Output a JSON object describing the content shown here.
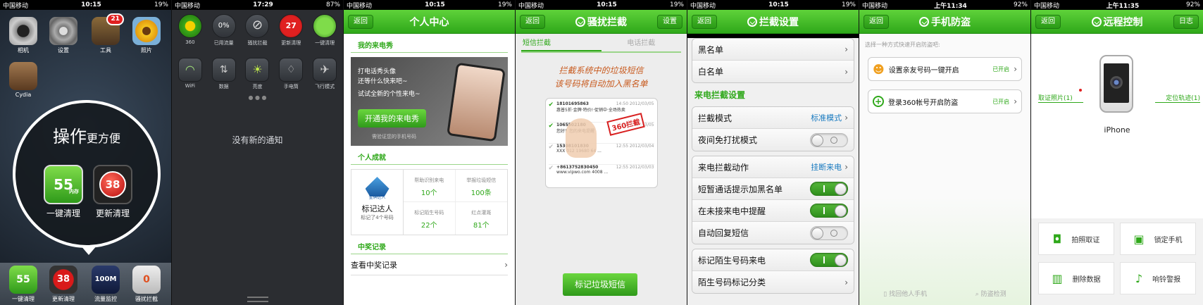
{
  "colors": {
    "brand_green": "#2fa81a",
    "badge_red": "#e02020",
    "link_blue": "#1a7bc0"
  },
  "screens": {
    "s1": {
      "status": {
        "carrier": "中国移动",
        "time": "10:15",
        "battery": "19%"
      },
      "apps": [
        {
          "label": "相机",
          "icon": "camera-icon"
        },
        {
          "label": "设置",
          "icon": "settings-gear-icon"
        },
        {
          "label": "工具",
          "icon": "folder-icon",
          "badge": "21"
        },
        {
          "label": "照片",
          "icon": "sunflower-icon"
        },
        {
          "label": "Cydia",
          "icon": "cydia-icon"
        }
      ],
      "bubble": {
        "title": "操作",
        "title_small": "更方便",
        "items": [
          {
            "label": "一键清理",
            "value": "55",
            "sub": "内存"
          },
          {
            "label": "更新清理",
            "value": "38"
          }
        ]
      },
      "dock": [
        {
          "label": "一键清理",
          "value": "55",
          "sub": "内存"
        },
        {
          "label": "更新清理",
          "value": "38"
        },
        {
          "label": "流量监控",
          "value": "100M",
          "sub": "剩余"
        },
        {
          "label": "骚扰拦截",
          "value": "0"
        }
      ]
    },
    "s2": {
      "status": {
        "carrier": "中国移动",
        "time": "17:29",
        "battery": "87%"
      },
      "row1": [
        {
          "label": "360",
          "icon": "360-logo-icon"
        },
        {
          "label": "已用流量",
          "value": "0%"
        },
        {
          "label": "骚扰拦截",
          "icon": "block-icon"
        },
        {
          "label": "更新清理",
          "value": "27"
        },
        {
          "label": "一键清理",
          "icon": "broom-icon"
        }
      ],
      "row2": [
        {
          "label": "WiFi",
          "icon": "wifi-icon"
        },
        {
          "label": "数据",
          "icon": "data-icon"
        },
        {
          "label": "亮度",
          "icon": "brightness-icon"
        },
        {
          "label": "手电筒",
          "icon": "flashlight-icon"
        },
        {
          "label": "飞行模式",
          "icon": "airplane-icon"
        }
      ],
      "empty": "没有新的通知"
    },
    "s3": {
      "status": {
        "carrier": "中国移动",
        "time": "10:15",
        "battery": "19%"
      },
      "back": "返回",
      "title": "个人中心",
      "show_header": "我的来电秀",
      "banner": {
        "line1": "打电话秀头像",
        "line2": "还等什么快来吧~",
        "line3": "试试全新的个性来电~",
        "button": "开通我的来电秀",
        "note": "需验证您的手机号码"
      },
      "ach_header": "个人成就",
      "badge_title": "标记达人",
      "badge_ribbon": "金牌达人",
      "badge_sub": "标记了4个号码",
      "stats": [
        {
          "label": "帮助识别来电",
          "value": "10个"
        },
        {
          "label": "举报垃圾短信",
          "value": "100条"
        },
        {
          "label": "标记陌生号码",
          "value": "22个"
        },
        {
          "label": "红点灌溉",
          "value": "81个"
        }
      ],
      "prize_header": "中奖记录",
      "prize_row": "查看中奖记录"
    },
    "s4": {
      "status": {
        "carrier": "中国移动",
        "time": "10:15",
        "battery": "19%"
      },
      "back": "返回",
      "title": "骚扰拦截",
      "settings": "设置",
      "tabs": [
        "短信拦截",
        "电话拦截"
      ],
      "hint1": "拦截系统中的垃圾短信",
      "hint2": "该号码将自动加入黑名单",
      "stamp": "360拦截",
      "msgs": [
        {
          "num": "18101695863",
          "time": "14:50 2012/03/05",
          "text": "惠普5折·金牌·特价!·促销中·全场热卖"
        },
        {
          "num": "1065502180",
          "time": "12:55 2012/03/05",
          "text": "您好！您的来电提醒"
        },
        {
          "num": "15308101830",
          "time": "12:55 2012/03/04",
          "text": "XXX 012 19680 64 ..."
        },
        {
          "num": "+8613752830450",
          "time": "12:55 2012/03/03",
          "text": "www.vipwo.com 4008 ..."
        }
      ],
      "button": "标记垃圾短信"
    },
    "s5": {
      "status": {
        "carrier": "中国移动",
        "time": "10:15",
        "battery": "19%"
      },
      "back": "返回",
      "title": "拦截设置",
      "rows_a": [
        "黑名单",
        "白名单"
      ],
      "section": "来电拦截设置",
      "mode_label": "拦截模式",
      "mode_value": "标准模式",
      "night_label": "夜间免打扰模式",
      "action_label": "来电拦截动作",
      "action_value": "挂断来电",
      "toggles": [
        "短暂通话提示加黑名单",
        "在未接来电中提醒",
        "自动回复短信"
      ],
      "mark_label": "标记陌生号码来电",
      "classify_label": "陌生号码标记分类"
    },
    "s6": {
      "status": {
        "carrier": "中国移动",
        "time": "上午11:34",
        "battery": "92%"
      },
      "back": "返回",
      "title": "手机防盗",
      "hint": "选择一种方式快速开启防盗吧:",
      "options": [
        {
          "label": "设置亲友号码一键开启",
          "status": "已开启",
          "icon": "contacts-icon"
        },
        {
          "label": "登录360帐号开启防盗",
          "status": "已开启",
          "icon": "plus-circle-icon"
        }
      ],
      "footer": [
        "找回他人手机",
        "防盗检测"
      ]
    },
    "s7": {
      "status": {
        "carrier": "中国移动",
        "time": "上午11:35",
        "battery": "92%"
      },
      "back": "返回",
      "title": "远程控制",
      "log": "日志",
      "device": "iPhone",
      "left_tag": "取证照片(1)",
      "right_tag": "定位轨迹(1)",
      "actions": [
        {
          "label": "拍照取证",
          "icon": "camera-icon"
        },
        {
          "label": "锁定手机",
          "icon": "lock-icon"
        },
        {
          "label": "删除数据",
          "icon": "trash-icon"
        },
        {
          "label": "响铃警报",
          "icon": "bell-icon"
        }
      ]
    }
  }
}
